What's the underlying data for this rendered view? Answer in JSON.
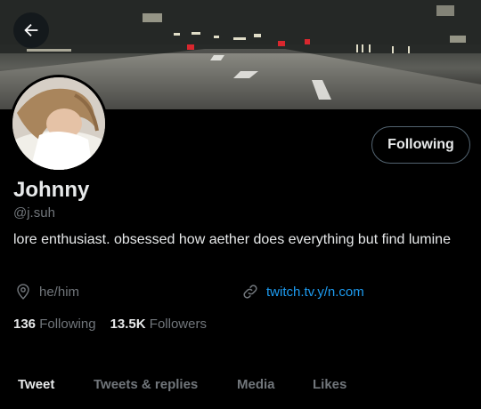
{
  "header": {
    "back_icon": "arrow-left-icon"
  },
  "banner": {
    "description_icon": "night-road-photo"
  },
  "profile": {
    "follow_button_label": "Following",
    "name": "Johnny",
    "handle": "@j.suh",
    "bio": "lore enthusiast. obsessed how aether does everything but find lumine",
    "location_icon": "location-pin-icon",
    "pronouns": "he/him",
    "link_icon": "link-icon",
    "link": "twitch.tv.y/n.com",
    "following_count": "136",
    "following_label": "Following",
    "followers_count": "13.5K",
    "followers_label": "Followers"
  },
  "tabs": [
    {
      "label": "Tweet",
      "active": true
    },
    {
      "label": "Tweets & replies",
      "active": false
    },
    {
      "label": "Media",
      "active": false
    },
    {
      "label": "Likes",
      "active": false
    }
  ],
  "colors": {
    "background": "#000000",
    "accent": "#1d9bf0",
    "secondary_text": "#71767b"
  }
}
